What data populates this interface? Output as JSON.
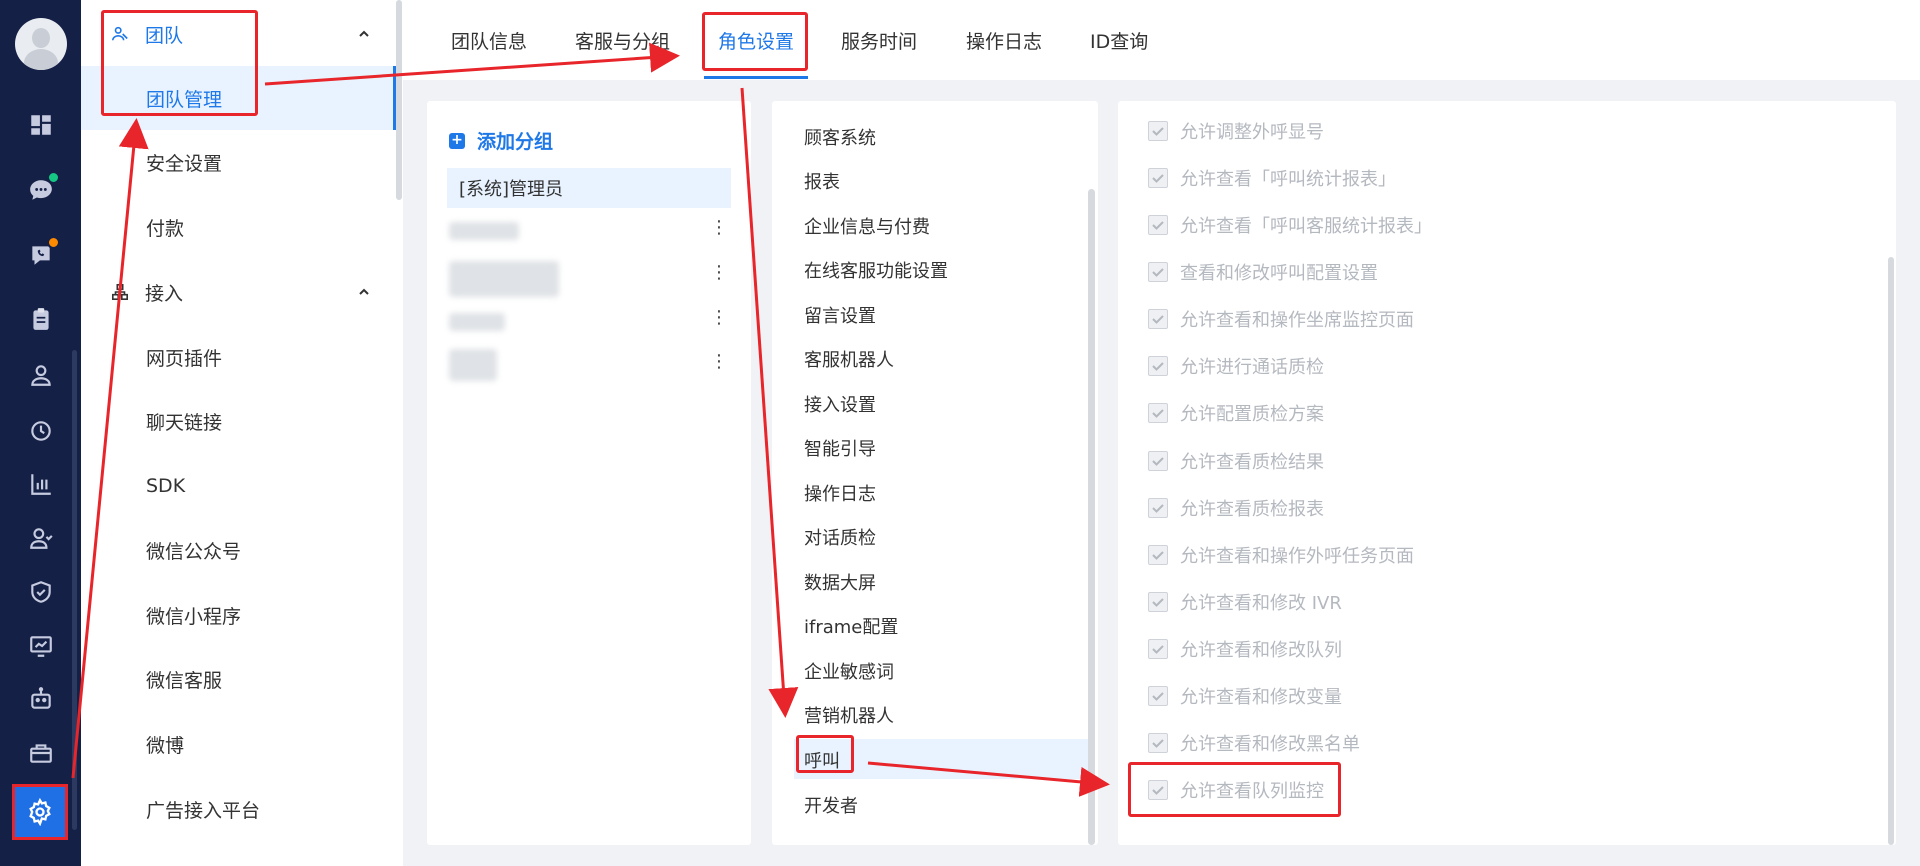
{
  "rail": {
    "icons": [
      "dashboard-icon",
      "chat-icon",
      "call-icon",
      "clipboard-icon",
      "user-icon",
      "history-icon",
      "stats-icon",
      "team-icon",
      "shield-icon",
      "monitor-icon",
      "robot-icon",
      "marketing-icon",
      "gear-icon"
    ],
    "badge_colors": {
      "chat": "#16c784",
      "call": "#ff8a00"
    }
  },
  "subnav": {
    "group_team": "团队",
    "team_items": [
      "团队管理",
      "安全设置",
      "付款"
    ],
    "group_access": "接入",
    "access_items": [
      "网页插件",
      "聊天链接",
      "SDK",
      "微信公众号",
      "微信小程序",
      "微信客服",
      "微博",
      "广告接入平台"
    ]
  },
  "tabs": [
    "团队信息",
    "客服与分组",
    "角色设置",
    "服务时间",
    "操作日志",
    "ID查询"
  ],
  "roles": {
    "add_label": "添加分组",
    "items": [
      "[系统]管理员"
    ],
    "menu_glyph": "⋮"
  },
  "modules": [
    "顾客系统",
    "报表",
    "企业信息与付费",
    "在线客服功能设置",
    "留言设置",
    "客服机器人",
    "接入设置",
    "智能引导",
    "操作日志",
    "对话质检",
    "数据大屏",
    "iframe配置",
    "企业敏感词",
    "营销机器人",
    "呼叫",
    "开发者"
  ],
  "permissions": [
    "允许调整外呼显号",
    "允许查看「呼叫统计报表」",
    "允许查看「呼叫客服统计报表」",
    "查看和修改呼叫配置设置",
    "允许查看和操作坐席监控页面",
    "允许进行通话质检",
    "允许配置质检方案",
    "允许查看质检结果",
    "允许查看质检报表",
    "允许查看和操作外呼任务页面",
    "允许查看和修改 IVR",
    "允许查看和修改队列",
    "允许查看和修改变量",
    "允许查看和修改黑名单",
    "允许查看队列监控"
  ],
  "colors": {
    "accent": "#1f78e8",
    "annotation": "#e8252a",
    "rail": "#142046"
  }
}
